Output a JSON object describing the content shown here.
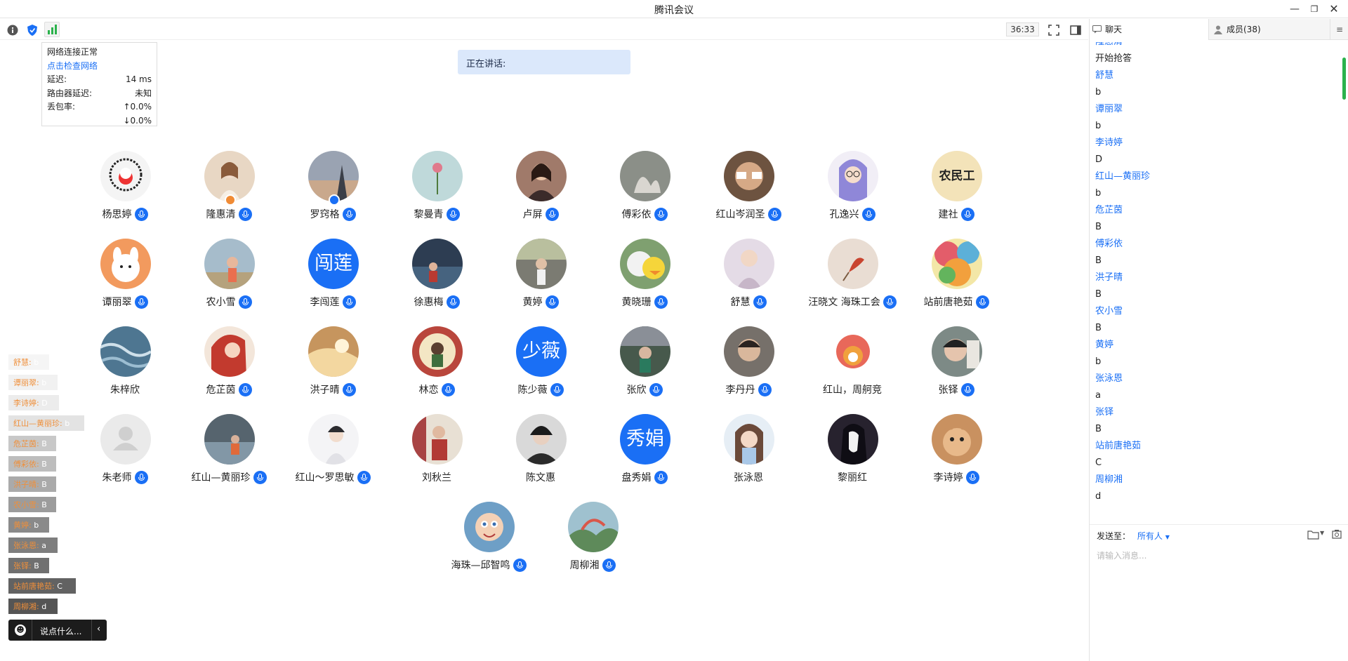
{
  "app": {
    "title": "腾讯会议"
  },
  "toolbar": {
    "timer": "36:33"
  },
  "network": {
    "status": "网络连接正常",
    "check_link": "点击检查网络",
    "latency_label": "延迟:",
    "latency_value": "14 ms",
    "router_label": "路由器延迟:",
    "router_value": "未知",
    "loss_label": "丢包率:",
    "loss_up": "↑0.0%",
    "loss_down": "↓0.0%"
  },
  "speaking": {
    "label": "正在讲话:"
  },
  "participants": [
    {
      "name": "杨思婷",
      "mic": true,
      "color": "#f4f4f4",
      "avatar_text": ""
    },
    {
      "name": "隆惠清",
      "mic": true,
      "color": "#e8d7c4",
      "avatar_text": ""
    },
    {
      "name": "罗窍格",
      "mic": true,
      "color": "#9aa3b2",
      "avatar_text": ""
    },
    {
      "name": "黎曼青",
      "mic": true,
      "color": "#bfd9da",
      "avatar_text": ""
    },
    {
      "name": "卢屏",
      "mic": true,
      "color": "#a07a6a",
      "avatar_text": ""
    },
    {
      "name": "傅彩依",
      "mic": true,
      "color": "#8b8f88",
      "avatar_text": ""
    },
    {
      "name": "红山岑润圣",
      "mic": true,
      "color": "#6d5340",
      "avatar_text": ""
    },
    {
      "name": "孔逸兴",
      "mic": true,
      "color": "#8f87d8",
      "avatar_text": ""
    },
    {
      "name": "建社",
      "mic": true,
      "color": "#f3e3b9",
      "avatar_text": "农民工"
    },
    {
      "name": "谭丽翠",
      "mic": true,
      "color": "#f29a5e",
      "avatar_text": ""
    },
    {
      "name": "农小雪",
      "mic": true,
      "color": "#a6bccb",
      "avatar_text": ""
    },
    {
      "name": "李闯莲",
      "mic": true,
      "color": "#1a6ff5",
      "avatar_text": "闯莲"
    },
    {
      "name": "徐惠梅",
      "mic": true,
      "color": "#2d3d52",
      "avatar_text": ""
    },
    {
      "name": "黄婷",
      "mic": true,
      "color": "#7b7b72",
      "avatar_text": ""
    },
    {
      "name": "黄晓珊",
      "mic": true,
      "color": "#d9d36a",
      "avatar_text": ""
    },
    {
      "name": "舒慧",
      "mic": true,
      "color": "#cdb7c9",
      "avatar_text": ""
    },
    {
      "name": "汪晓文 海珠工会",
      "mic": true,
      "color": "#e9ddd3",
      "avatar_text": ""
    },
    {
      "name": "站前唐艳茹",
      "mic": true,
      "color": "#d96a7c",
      "avatar_text": ""
    },
    {
      "name": "朱梓欣",
      "mic": false,
      "color": "#4e7691",
      "avatar_text": ""
    },
    {
      "name": "危芷茵",
      "mic": true,
      "color": "#c23a2e",
      "avatar_text": ""
    },
    {
      "name": "洪子晴",
      "mic": true,
      "color": "#c6955e",
      "avatar_text": ""
    },
    {
      "name": "林恋",
      "mic": true,
      "color": "#b9463c",
      "avatar_text": ""
    },
    {
      "name": "陈少薇",
      "mic": true,
      "color": "#1a6ff5",
      "avatar_text": "少薇"
    },
    {
      "name": "张欣",
      "mic": true,
      "color": "#47594c",
      "avatar_text": ""
    },
    {
      "name": "李丹丹",
      "mic": true,
      "color": "#76706a",
      "avatar_text": ""
    },
    {
      "name": "红山，周舸竞",
      "mic": false,
      "color": "#f0a13d",
      "avatar_text": ""
    },
    {
      "name": "张铎",
      "mic": true,
      "color": "#7d8a86",
      "avatar_text": ""
    },
    {
      "name": "朱老师",
      "mic": true,
      "color": "#e6e6e6",
      "avatar_text": ""
    },
    {
      "name": "红山—黄丽珍",
      "mic": true,
      "color": "#56646e",
      "avatar_text": ""
    },
    {
      "name": "红山～罗思敏",
      "mic": true,
      "color": "#e9e9ec",
      "avatar_text": ""
    },
    {
      "name": "刘秋兰",
      "mic": false,
      "color": "#a84444",
      "avatar_text": ""
    },
    {
      "name": "陈文惠",
      "mic": false,
      "color": "#3b3b3b",
      "avatar_text": ""
    },
    {
      "name": "盘秀娟",
      "mic": true,
      "color": "#1a6ff5",
      "avatar_text": "秀娟"
    },
    {
      "name": "张泳恩",
      "mic": false,
      "color": "#c9a79a",
      "avatar_text": ""
    },
    {
      "name": "黎丽红",
      "mic": false,
      "color": "#27222e",
      "avatar_text": ""
    },
    {
      "name": "李诗婷",
      "mic": true,
      "color": "#c99160",
      "avatar_text": ""
    },
    {
      "name": "海珠—邱智鸣",
      "mic": true,
      "color": "#6e9fc6",
      "avatar_text": ""
    },
    {
      "name": "周柳湘",
      "mic": true,
      "color": "#5e8a5a",
      "avatar_text": ""
    }
  ],
  "danmu": [
    {
      "name": "舒慧:",
      "text": "b"
    },
    {
      "name": "谭丽翠:",
      "text": "b"
    },
    {
      "name": "李诗婷:",
      "text": "D"
    },
    {
      "name": "红山—黄丽珍:",
      "text": "b"
    },
    {
      "name": "危芷茵:",
      "text": "B"
    },
    {
      "name": "傅彩依:",
      "text": "B"
    },
    {
      "name": "洪子晴:",
      "text": "B"
    },
    {
      "name": "农小雪:",
      "text": "B"
    },
    {
      "name": "黄婷:",
      "text": "b"
    },
    {
      "name": "张泳恩:",
      "text": "a"
    },
    {
      "name": "张铎:",
      "text": "B"
    },
    {
      "name": "站前唐艳茹:",
      "text": "C"
    },
    {
      "name": "周柳湘:",
      "text": "d"
    }
  ],
  "say_input": {
    "placeholder": "说点什么..."
  },
  "panel": {
    "tab_chat": "聊天",
    "tab_members": "成员(38)",
    "messages": [
      {
        "name": "隆惠清",
        "text": "开始抢答"
      },
      {
        "name": "舒慧",
        "text": "b"
      },
      {
        "name": "谭丽翠",
        "text": "b"
      },
      {
        "name": "李诗婷",
        "text": "D"
      },
      {
        "name": "红山—黄丽珍",
        "text": "b"
      },
      {
        "name": "危芷茵",
        "text": "B"
      },
      {
        "name": "傅彩依",
        "text": "B"
      },
      {
        "name": "洪子晴",
        "text": "B"
      },
      {
        "name": "农小雪",
        "text": "B"
      },
      {
        "name": "黄婷",
        "text": "b"
      },
      {
        "name": "张泳恩",
        "text": "a"
      },
      {
        "name": "张铎",
        "text": "B"
      },
      {
        "name": "站前唐艳茹",
        "text": "C"
      },
      {
        "name": "周柳湘",
        "text": "d"
      }
    ],
    "send_to_label": "发送至：",
    "send_to_value": "所有人",
    "input_placeholder": "请输入消息..."
  }
}
